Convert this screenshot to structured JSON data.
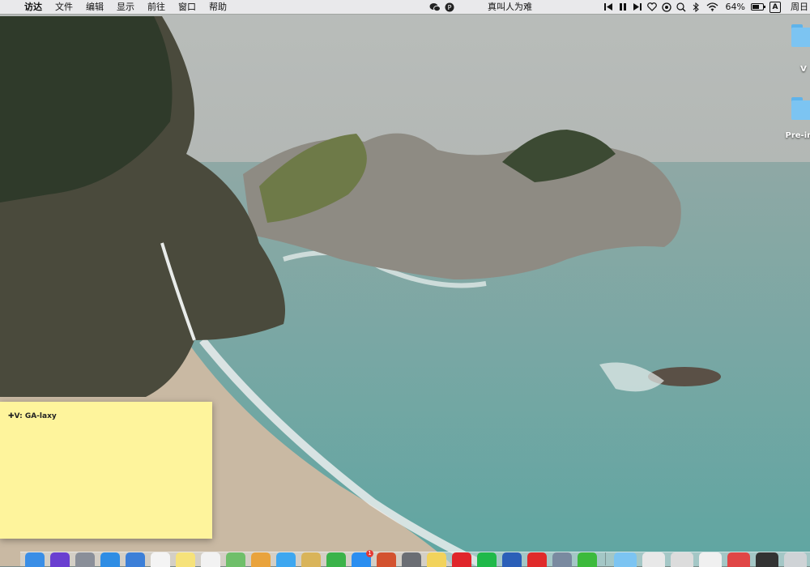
{
  "menubar": {
    "apple_glyph": "",
    "items": [
      "访达",
      "文件",
      "编辑",
      "显示",
      "前往",
      "窗口",
      "帮助"
    ],
    "now_playing": "真叫人为难",
    "battery_percent": "64%",
    "battery_level": 0.64,
    "input_method": "A",
    "clock": "周日",
    "icons": [
      "wechat-icon",
      "p-icon",
      "previous-track-icon",
      "pause-icon",
      "next-track-icon",
      "heart-icon",
      "netease-icon",
      "qq-icon",
      "bluetooth-icon",
      "wifi-icon",
      "battery-icon"
    ]
  },
  "desktop": {
    "items": [
      {
        "label": "V",
        "icon": "folder-icon"
      },
      {
        "label": "Pre-info",
        "icon": "folder-icon"
      }
    ]
  },
  "sticky": {
    "text": "✚V: GA-laxy"
  },
  "dock": {
    "apps": [
      {
        "name": "finder-icon",
        "color": "#3a8ee6"
      },
      {
        "name": "siri-icon",
        "color": "#6a3fd0"
      },
      {
        "name": "launchpad-icon",
        "color": "#8a8f99"
      },
      {
        "name": "safari-icon",
        "color": "#2f8de4"
      },
      {
        "name": "mail-icon",
        "color": "#3c7fd8"
      },
      {
        "name": "calendar-icon",
        "color": "#f4f4f4"
      },
      {
        "name": "notes-icon",
        "color": "#f6e27a"
      },
      {
        "name": "reminders-icon",
        "color": "#f2f2f2"
      },
      {
        "name": "maps-icon",
        "color": "#6fbf6a"
      },
      {
        "name": "photos-icon",
        "color": "#e9a33c"
      },
      {
        "name": "messages-icon",
        "color": "#3ea7f0"
      },
      {
        "name": "preview-icon",
        "color": "#d9b45a"
      },
      {
        "name": "numbers-icon",
        "color": "#3bb34a"
      },
      {
        "name": "app-store-icon",
        "color": "#2b8ef0"
      },
      {
        "name": "powerpoint-icon",
        "color": "#d3522f"
      },
      {
        "name": "system-preferences-icon",
        "color": "#6b6e74"
      },
      {
        "name": "stickies-icon",
        "color": "#f2d35c"
      },
      {
        "name": "youdao-icon",
        "color": "#e0262b"
      },
      {
        "name": "iqiyi-icon",
        "color": "#1fb94a"
      },
      {
        "name": "word-icon",
        "color": "#2b5fb8"
      },
      {
        "name": "netease-music-icon",
        "color": "#e02b2b"
      },
      {
        "name": "screenshot-icon",
        "color": "#7a8aa0"
      },
      {
        "name": "wechat-icon",
        "color": "#3cba3c"
      }
    ],
    "right_items": [
      {
        "name": "downloads-folder-icon",
        "color": "#7cc4f2"
      },
      {
        "name": "document-thumb-1",
        "color": "#e8e8e8"
      },
      {
        "name": "document-thumb-2",
        "color": "#dcdcdc"
      },
      {
        "name": "document-thumb-3",
        "color": "#f0f0f0"
      },
      {
        "name": "calendar-thumb",
        "color": "#e04646"
      },
      {
        "name": "terminal-thumb",
        "color": "#333333"
      },
      {
        "name": "trash-icon",
        "color": "#cfd3d6"
      }
    ],
    "app_store_badge": "1"
  }
}
